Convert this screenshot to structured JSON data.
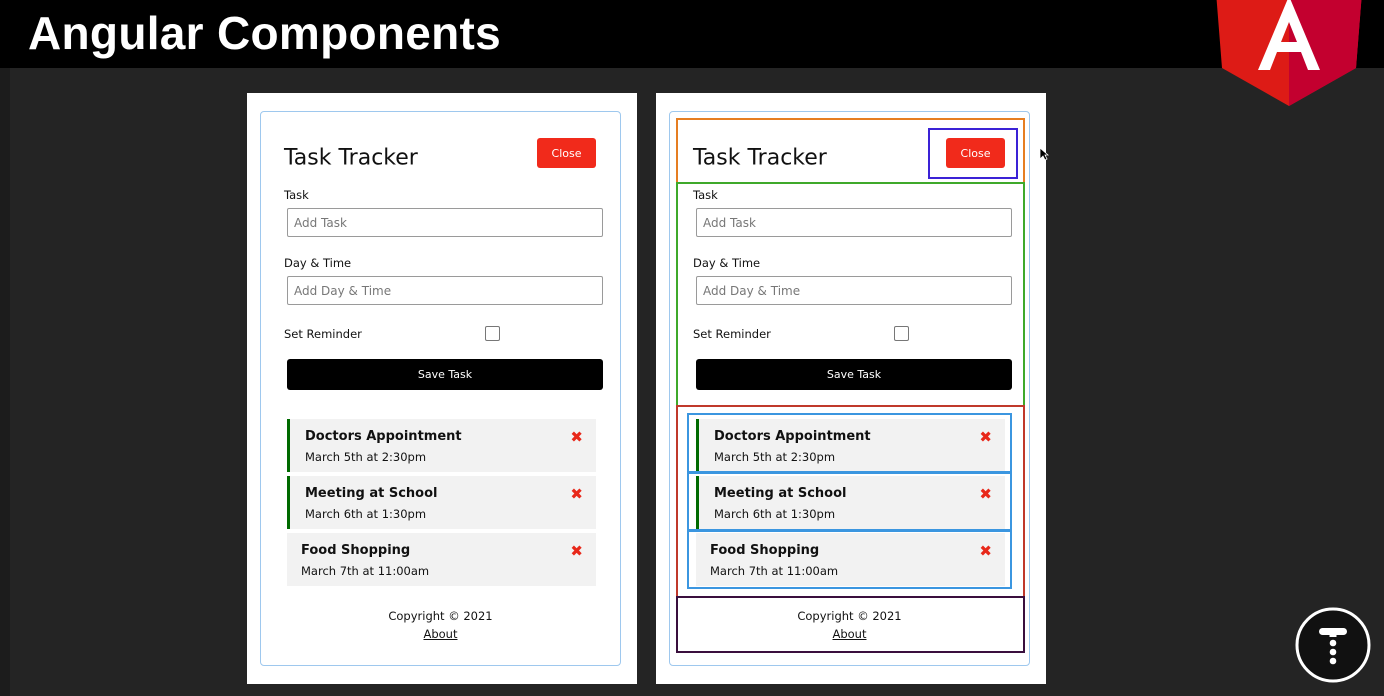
{
  "slide": {
    "title": "Angular Components"
  },
  "app": {
    "title": "Task Tracker",
    "close_label": "Close",
    "form": {
      "task_label": "Task",
      "task_placeholder": "Add Task",
      "daytime_label": "Day & Time",
      "daytime_placeholder": "Add Day & Time",
      "reminder_label": "Set Reminder",
      "reminder_checked": false,
      "save_label": "Save Task"
    },
    "tasks": [
      {
        "text": "Doctors Appointment",
        "day": "March 5th at 2:30pm",
        "reminder": true
      },
      {
        "text": "Meeting at School",
        "day": "March 6th at 1:30pm",
        "reminder": true
      },
      {
        "text": "Food Shopping",
        "day": "March 7th at 11:00am",
        "reminder": false
      }
    ],
    "delete_icon": "times-icon",
    "footer": {
      "copyright": "Copyright © 2021",
      "about_link": "About"
    }
  },
  "colors": {
    "accent_red": "#f12a1b",
    "reminder_green": "#006a00",
    "header_highlight": "#e67e22",
    "button_highlight": "#3b22d6",
    "form_highlight": "#3fa92a",
    "tasks_highlight": "#c0392b",
    "task_highlight": "#3b96e0",
    "footer_highlight": "#3a0f3d"
  }
}
